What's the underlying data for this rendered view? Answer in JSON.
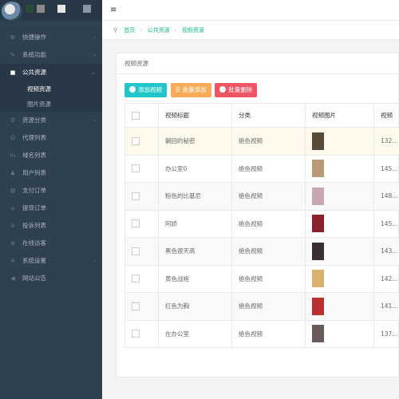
{
  "sidebar": {
    "items": [
      {
        "icon": "dashboard-icon",
        "glyph": "⧉",
        "label": "快捷操作",
        "chevron": "‹"
      },
      {
        "icon": "wrench-icon",
        "glyph": "✎",
        "label": "系统功能",
        "chevron": "‹"
      },
      {
        "icon": "video-icon",
        "glyph": "■",
        "label": "公共资源",
        "chevron": "⌄",
        "active": true
      },
      {
        "icon": "list-icon",
        "glyph": "☰",
        "label": "资源分类",
        "chevron": "‹"
      },
      {
        "icon": "users-icon",
        "glyph": "☺",
        "label": "代理列表",
        "chevron": ""
      },
      {
        "icon": "linkedin-icon",
        "glyph": "in",
        "label": "域名列表",
        "chevron": ""
      },
      {
        "icon": "user-icon",
        "glyph": "♟",
        "label": "用户列表",
        "chevron": ""
      },
      {
        "icon": "order-icon",
        "glyph": "▤",
        "label": "支付订单",
        "chevron": ""
      },
      {
        "icon": "bank-icon",
        "glyph": "⌂",
        "label": "提现订单",
        "chevron": ""
      },
      {
        "icon": "complaint-icon",
        "glyph": "⊘",
        "label": "投诉列表",
        "chevron": ""
      },
      {
        "icon": "globe-icon",
        "glyph": "⊕",
        "label": "在线访客",
        "chevron": ""
      },
      {
        "icon": "gear-icon",
        "glyph": "✲",
        "label": "系统设置",
        "chevron": "‹"
      },
      {
        "icon": "bullhorn-icon",
        "glyph": "◀",
        "label": "网站公告",
        "chevron": ""
      }
    ],
    "submenu": [
      "视频资源",
      "图片资源"
    ]
  },
  "breadcrumb": {
    "home": "首页",
    "section": "公共资源",
    "current": "视频资源"
  },
  "panel": {
    "title": "视频资源"
  },
  "buttons": {
    "add": "添加视频",
    "bulk_add": "批量添加",
    "bulk_delete": "批量删除"
  },
  "table": {
    "headers": [
      "视频标题",
      "分类",
      "视频图片",
      "视频"
    ],
    "rows": [
      {
        "title": "躺回的秘密",
        "category": "绝色视频",
        "views": "132..."
      },
      {
        "title": "办公室0",
        "category": "绝色视频",
        "views": "145..."
      },
      {
        "title": "粉色的比基尼",
        "category": "绝色视频",
        "views": "148..."
      },
      {
        "title": "阿娇",
        "category": "绝色视频",
        "views": "145..."
      },
      {
        "title": "黑色很天高",
        "category": "绝色视频",
        "views": "143..."
      },
      {
        "title": "黄色战袍",
        "category": "绝色视频",
        "views": "142..."
      },
      {
        "title": "红色为胸",
        "category": "绝色视频",
        "views": "141..."
      },
      {
        "title": "在办公室",
        "category": "绝色视频",
        "views": "137..."
      }
    ]
  },
  "thumb_colors": [
    "#5a4a3a",
    "#b89a7a",
    "#c8a8b0",
    "#8a2030",
    "#3a3030",
    "#d8b070",
    "#b83030",
    "#6a5a5a"
  ]
}
